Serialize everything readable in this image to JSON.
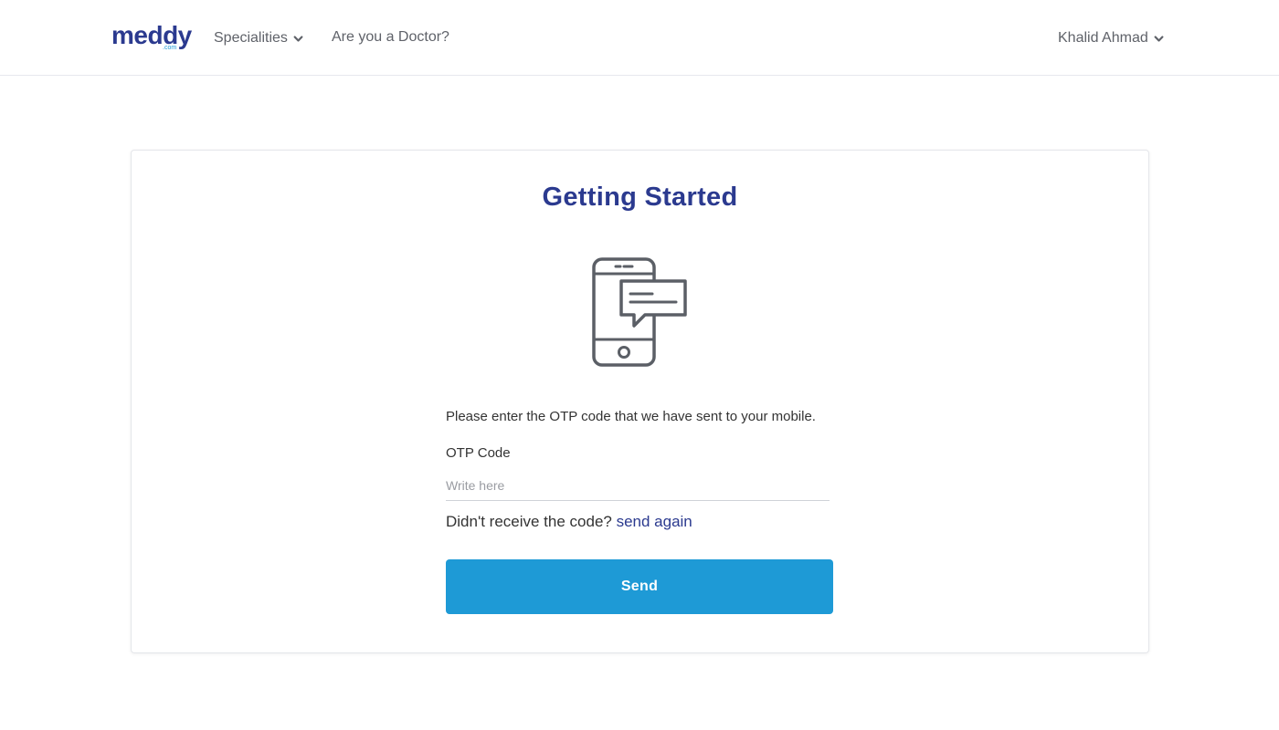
{
  "header": {
    "logo": {
      "word": "meddy",
      "sub": ".com"
    },
    "nav": {
      "specialities_label": "Specialities",
      "doctor_label": "Are you a Doctor?"
    },
    "user": {
      "name": "Khalid Ahmad"
    }
  },
  "card": {
    "title": "Getting Started",
    "instructions": "Please enter the OTP code that we have sent to your mobile.",
    "otp": {
      "label": "OTP Code",
      "placeholder": "Write here",
      "value": ""
    },
    "resend": {
      "prompt": "Didn't receive the code?",
      "link_label": "send again"
    },
    "send_label": "Send"
  },
  "colors": {
    "brand": "#2b3a8f",
    "accent": "#1e9ad6",
    "icon": "#5b5f66"
  },
  "icons": {
    "phone": "phone-message-icon",
    "chevron": "chevron-down-icon"
  }
}
